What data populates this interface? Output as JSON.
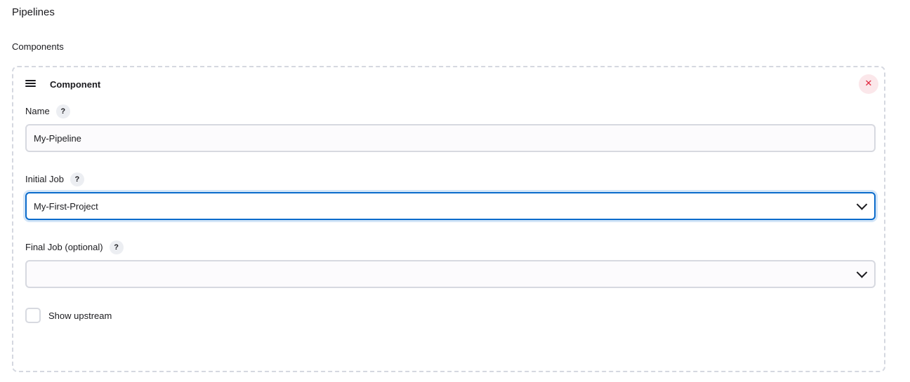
{
  "section": {
    "title": "Pipelines",
    "components_label": "Components"
  },
  "component": {
    "title": "Component",
    "delete_glyph": "✕",
    "drag_icon": "hamburger-icon",
    "name": {
      "label": "Name",
      "help": "?",
      "value": "My-Pipeline"
    },
    "initial_job": {
      "label": "Initial Job",
      "help": "?",
      "selected": "My-First-Project"
    },
    "final_job": {
      "label": "Final Job (optional)",
      "help": "?",
      "selected": ""
    },
    "show_upstream": {
      "label": "Show upstream",
      "checked": false
    }
  },
  "colors": {
    "focus_border": "#0b6bcb",
    "delete_bg": "#fbe7ea",
    "delete_fg": "#e0243b",
    "dashed_border": "#d5d8e0"
  }
}
